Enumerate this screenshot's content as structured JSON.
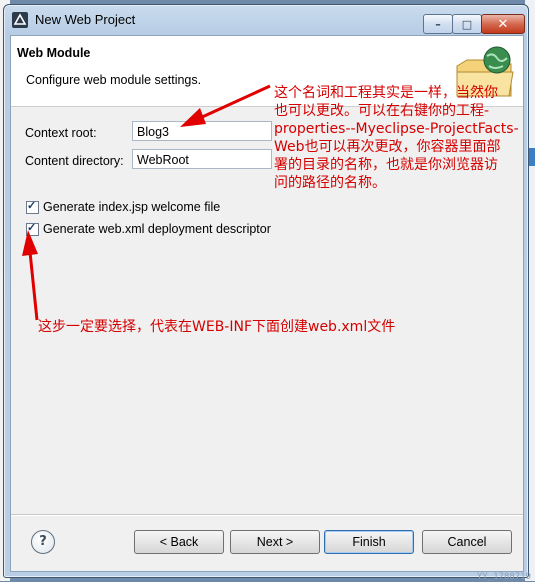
{
  "window": {
    "title": "New Web Project",
    "controls": {
      "minimize": "–",
      "maximize": "□",
      "close": "✕"
    }
  },
  "banner": {
    "title": "Web Module",
    "description": "Configure web module settings.",
    "icon": "web-project-wizard-icon"
  },
  "form": {
    "context_root": {
      "label": "Context root:",
      "value": "Blog3"
    },
    "content_directory": {
      "label": "Content directory:",
      "value": "WebRoot"
    },
    "checkboxes": [
      {
        "label": "Generate index.jsp welcome file",
        "checked": true
      },
      {
        "label": "Generate web.xml deployment descriptor",
        "checked": true
      }
    ]
  },
  "annotations": {
    "top_lines": [
      "这个名词和工程其实是一样，当然你",
      "也可以更改。可以在右键你的工程-",
      "properties--Myeclipse-ProjectFacts-",
      "Web也可以再次更改，你容器里面部",
      "署的目录的名称，也就是你浏览器访",
      "问的路径的名称。"
    ],
    "bottom": "这步一定要选择，代表在WEB-INF下面创建web.xml文件",
    "color": "#d40000"
  },
  "footer": {
    "help": "?",
    "back": "< Back",
    "next": "Next >",
    "finish": "Finish",
    "cancel": "Cancel"
  },
  "watermark": "YY_1788719"
}
